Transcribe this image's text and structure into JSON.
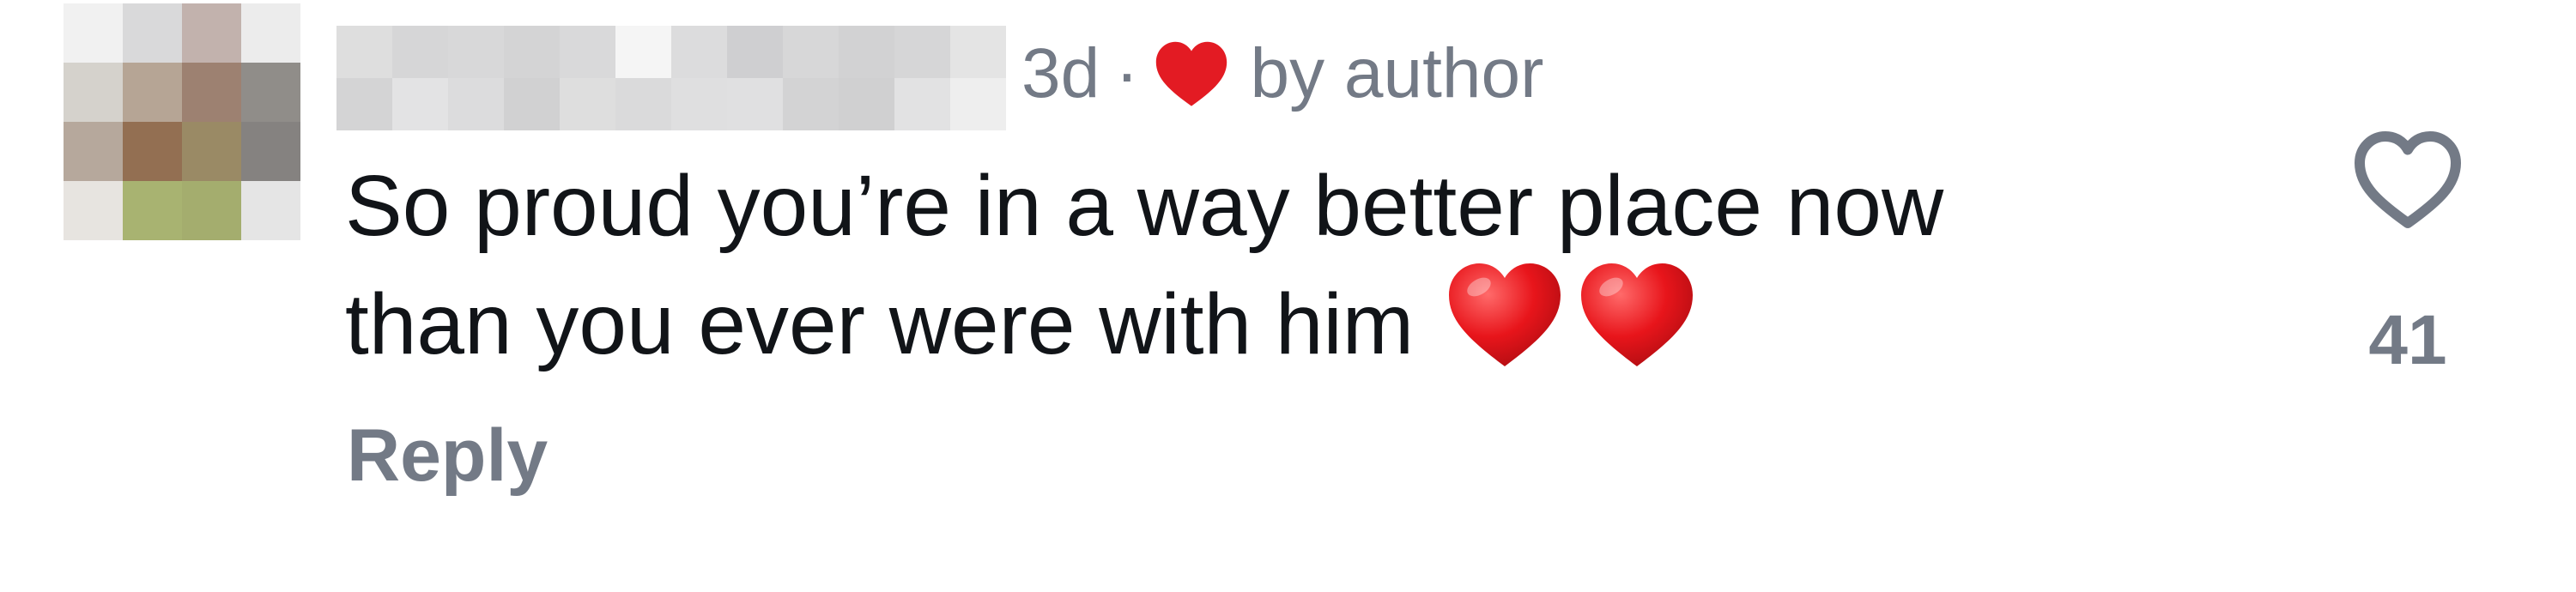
{
  "comment": {
    "time_ago": "3d",
    "separator": "·",
    "liked_by": "by author",
    "text_line1": "So proud you’re in a way better place now",
    "text_line2": "than you ever were with him",
    "emoji_icons": [
      "red-heart-emoji",
      "red-heart-emoji"
    ],
    "reply_label": "Reply",
    "like_count": "41"
  },
  "colors": {
    "meta_gray": "#737a86",
    "text": "#111418",
    "heart_red": "#e31b23"
  }
}
